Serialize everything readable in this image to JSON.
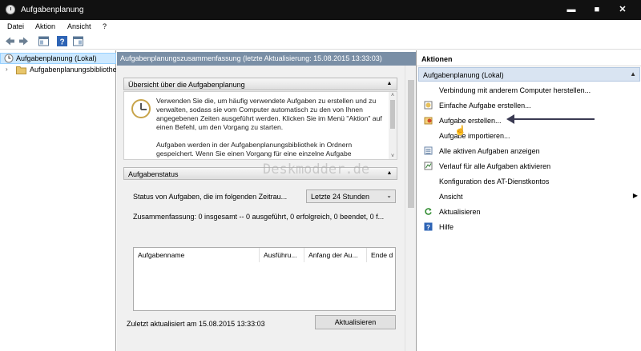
{
  "window": {
    "title": "Aufgabenplanung",
    "min": "▬",
    "max": "■",
    "close": "✕"
  },
  "menu": [
    "Datei",
    "Aktion",
    "Ansicht",
    "?"
  ],
  "tree": {
    "root": "Aufgabenplanung (Lokal)",
    "child": "Aufgabenplanungsbibliothek"
  },
  "center": {
    "header": "Aufgabenplanungszusammenfassung (letzte Aktualisierung: 15.08.2015 13:33:03)",
    "overview_title": "Übersicht über die Aufgabenplanung",
    "overview_text_1": "Verwenden Sie die, um häufig verwendete Aufgaben zu erstellen und zu verwalten, sodass sie vom Computer automatisch zu den von Ihnen angegebenen Zeiten ausgeführt werden. Klicken Sie im Menü \"Aktion\" auf einen Befehl, um den Vorgang zu starten.",
    "overview_text_2": "Aufgaben werden in der Aufgabenplanungsbibliothek in Ordnern gespeichert. Wenn Sie einen Vorgang für eine einzelne Aufgabe",
    "status_title": "Aufgabenstatus",
    "status_label": "Status von Aufgaben, die im folgenden Zeitrau...",
    "status_select": "Letzte 24 Stunden",
    "summary": "Zusammenfassung: 0 insgesamt -- 0 ausgeführt, 0 erfolgreich, 0 beendet, 0 f...",
    "columns": [
      "Aufgabenname",
      "Ausführu...",
      "Anfang der Au...",
      "Ende d"
    ],
    "last_updated": "Zuletzt aktualisiert am 15.08.2015 13:33:03",
    "refresh_button": "Aktualisieren"
  },
  "actions": {
    "title": "Aktionen",
    "group": "Aufgabenplanung (Lokal)",
    "items": [
      "Verbindung mit anderem Computer herstellen...",
      "Einfache Aufgabe erstellen...",
      "Aufgabe erstellen...",
      "Aufgabe importieren...",
      "Alle aktiven Aufgaben anzeigen",
      "Verlauf für alle Aufgaben aktivieren",
      "Konfiguration des AT-Dienstkontos",
      "Ansicht",
      "Aktualisieren",
      "Hilfe"
    ]
  },
  "watermark": "Deskmodder.de"
}
